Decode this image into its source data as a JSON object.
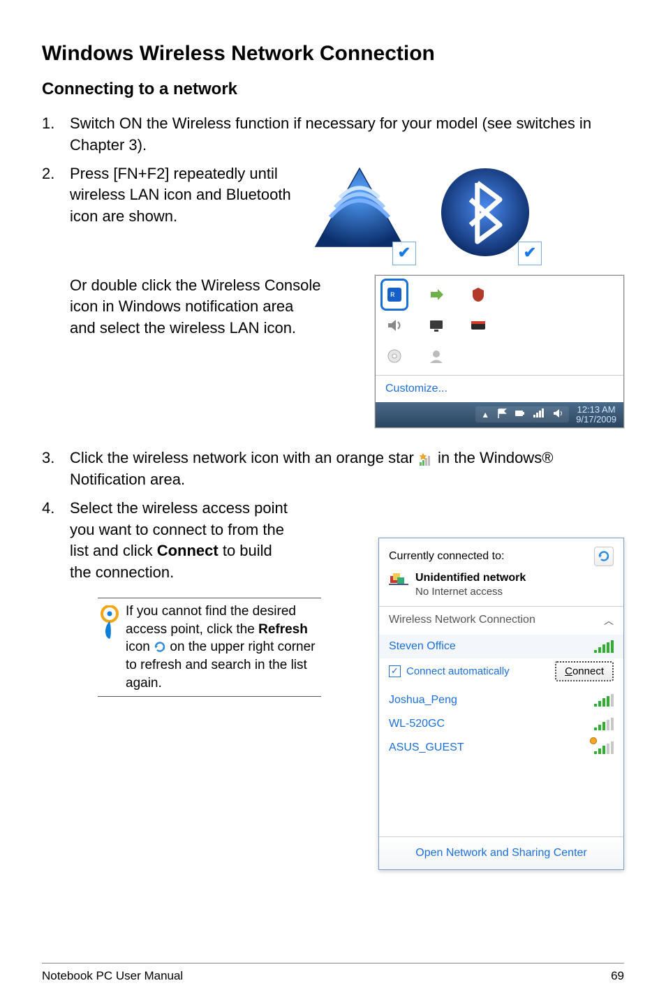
{
  "title": "Windows Wireless Network Connection",
  "subtitle": "Connecting to a network",
  "steps": {
    "s1_num": "1.",
    "s1": "Switch ON the Wireless function if necessary for your model (see switches in Chapter 3).",
    "s2_num": "2.",
    "s2": "Press [FN+F2] repeatedly until wireless LAN icon and Bluetooth icon are shown.",
    "s2b": "Or double click the Wireless Console icon in Windows notification area and select the wireless LAN icon.",
    "s3_num": "3.",
    "s3_a": "Click the wireless network icon with an orange star ",
    "s3_b": " in the Windows® Notification area.",
    "s4_num": "4.",
    "s4_a": "Select the wireless access point you want to connect to from the list and click ",
    "s4_bold": "Connect",
    "s4_b": " to build the connection."
  },
  "tip": {
    "a": "If you cannot find the desired access point, click the ",
    "refresh_bold": "Refresh",
    "b": " icon ",
    "c": " on the upper right corner to refresh and search in the list again."
  },
  "tray": {
    "customize": "Customize...",
    "time": "12:13 AM",
    "date": "9/17/2009"
  },
  "panel": {
    "connected_to": "Currently connected to:",
    "net_name": "Unidentified network",
    "net_status": "No Internet access",
    "section": "Wireless Network Connection",
    "items": [
      "Steven Office",
      "Joshua_Peng",
      "WL-520GC",
      "ASUS_GUEST"
    ],
    "auto": "Connect automatically",
    "connect_pre": "C",
    "connect_rest": "onnect",
    "footer": "Open Network and Sharing Center"
  },
  "footer": {
    "left": "Notebook PC User Manual",
    "right": "69"
  }
}
